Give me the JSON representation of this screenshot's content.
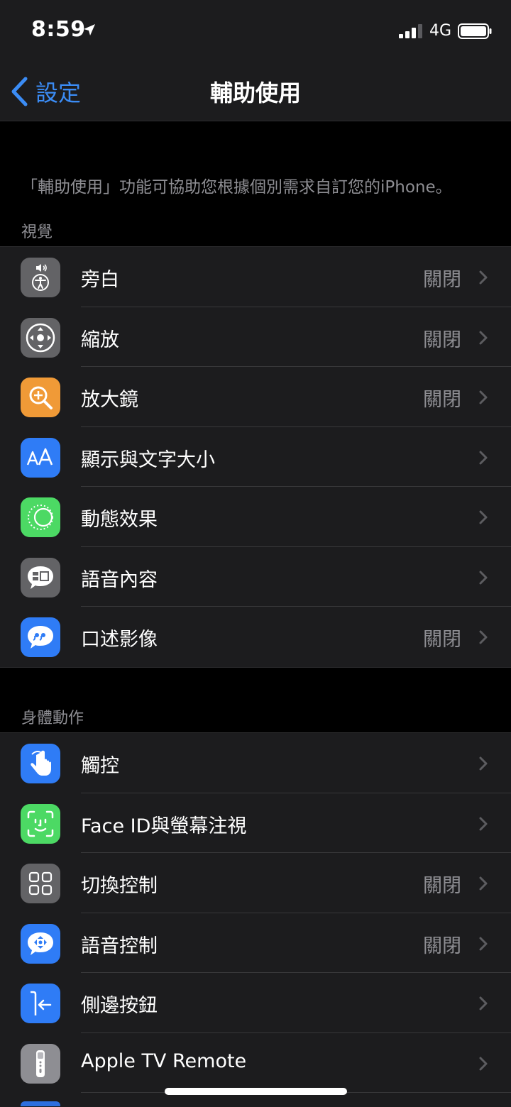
{
  "status": {
    "time": "8:59",
    "carrier": "4G"
  },
  "nav": {
    "back_label": "設定",
    "title": "輔助使用"
  },
  "intro": "「輔助使用」功能可協助您根據個別需求自訂您的iPhone。",
  "sections": [
    {
      "header": "視覺",
      "rows": [
        {
          "label": "旁白",
          "value": "關閉",
          "icon": "voiceover-icon",
          "color": "#636366"
        },
        {
          "label": "縮放",
          "value": "關閉",
          "icon": "zoom-icon",
          "color": "#636366"
        },
        {
          "label": "放大鏡",
          "value": "關閉",
          "icon": "magnifier-icon",
          "color": "#f09a37"
        },
        {
          "label": "顯示與文字大小",
          "value": "",
          "icon": "text-size-icon",
          "color": "#2f7cf6"
        },
        {
          "label": "動態效果",
          "value": "",
          "icon": "motion-icon",
          "color": "#4cd964"
        },
        {
          "label": "語音內容",
          "value": "",
          "icon": "spoken-content-icon",
          "color": "#636366"
        },
        {
          "label": "口述影像",
          "value": "關閉",
          "icon": "audio-description-icon",
          "color": "#2f7cf6"
        }
      ]
    },
    {
      "header": "身體動作",
      "rows": [
        {
          "label": "觸控",
          "value": "",
          "icon": "touch-icon",
          "color": "#2f7cf6"
        },
        {
          "label": "Face ID與螢幕注視",
          "value": "",
          "icon": "face-id-icon",
          "color": "#4cd964"
        },
        {
          "label": "切換控制",
          "value": "關閉",
          "icon": "switch-control-icon",
          "color": "#636366"
        },
        {
          "label": "語音控制",
          "value": "關閉",
          "icon": "voice-control-icon",
          "color": "#2f7cf6"
        },
        {
          "label": "側邊按鈕",
          "value": "",
          "icon": "side-button-icon",
          "color": "#2f7cf6"
        },
        {
          "label": "Apple TV Remote",
          "value": "",
          "icon": "tv-remote-icon",
          "color": "#8e8e93"
        }
      ]
    }
  ]
}
